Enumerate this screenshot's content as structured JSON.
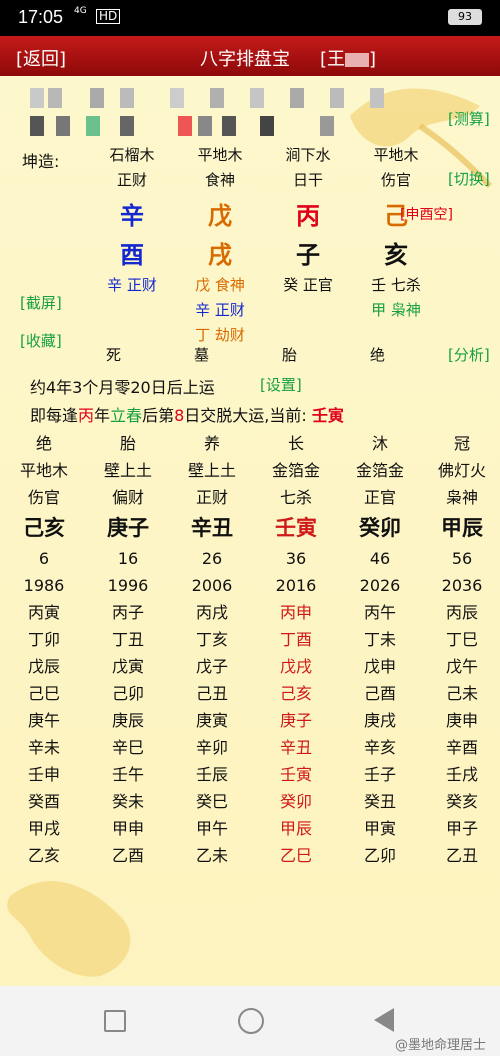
{
  "status": {
    "time": "17:05",
    "network": "4G",
    "hd": "HD",
    "battery": "93"
  },
  "header": {
    "back": "[返回]",
    "title": "八字排盘宝",
    "name_prefix": "[王",
    "name_suffix": "]"
  },
  "buttons": {
    "measure": "[测算]",
    "switch": "[切换]",
    "screenshot": "[截屏]",
    "favorite": "[收藏]",
    "analysis": "[分析]",
    "settings": "[设置]"
  },
  "chart": {
    "label": "坤造:",
    "nayin": [
      "石榴木",
      "平地木",
      "涧下水",
      "平地木"
    ],
    "shishen": [
      "正财",
      "食神",
      "日干",
      "伤官"
    ],
    "stems": [
      "辛",
      "戊",
      "丙",
      "己"
    ],
    "branches": [
      "酉",
      "戌",
      "子",
      "亥"
    ],
    "void_note": "[申酉空]",
    "hidden": [
      [
        "辛 正财"
      ],
      [
        "戊 食神",
        "辛 正财",
        "丁 劫财"
      ],
      [
        "癸 正官"
      ],
      [
        "壬 七杀",
        "甲 枭神"
      ]
    ],
    "changsheng": [
      "死",
      "墓",
      "胎",
      "绝"
    ]
  },
  "yun": {
    "line1": "约4年3个月零20日后上运",
    "line2_a": "即每逢",
    "line2_b": "丙",
    "line2_c": "年",
    "line2_d": "立春",
    "line2_e": "后第",
    "line2_f": "8",
    "line2_g": "日交脱大运,当前: ",
    "line2_h": "壬寅"
  },
  "dayun": [
    {
      "cs": "绝",
      "nayin": "平地木",
      "shishen": "伤官",
      "gz": "己亥",
      "age": "6",
      "year": "1986",
      "years": [
        "丙寅",
        "丁卯",
        "戊辰",
        "己巳",
        "庚午",
        "辛未",
        "壬申",
        "癸酉",
        "甲戌",
        "乙亥"
      ]
    },
    {
      "cs": "胎",
      "nayin": "壁上土",
      "shishen": "偏财",
      "gz": "庚子",
      "age": "16",
      "year": "1996",
      "years": [
        "丙子",
        "丁丑",
        "戊寅",
        "己卯",
        "庚辰",
        "辛巳",
        "壬午",
        "癸未",
        "甲申",
        "乙酉"
      ]
    },
    {
      "cs": "养",
      "nayin": "壁上土",
      "shishen": "正财",
      "gz": "辛丑",
      "age": "26",
      "year": "2006",
      "years": [
        "丙戌",
        "丁亥",
        "戊子",
        "己丑",
        "庚寅",
        "辛卯",
        "壬辰",
        "癸巳",
        "甲午",
        "乙未"
      ]
    },
    {
      "cs": "长",
      "nayin": "金箔金",
      "shishen": "七杀",
      "gz": "壬寅",
      "age": "36",
      "year": "2016",
      "years": [
        "丙申",
        "丁酉",
        "戊戌",
        "己亥",
        "庚子",
        "辛丑",
        "壬寅",
        "癸卯",
        "甲辰",
        "乙巳"
      ]
    },
    {
      "cs": "沐",
      "nayin": "金箔金",
      "shishen": "正官",
      "gz": "癸卯",
      "age": "46",
      "year": "2026",
      "years": [
        "丙午",
        "丁未",
        "戊申",
        "己酉",
        "庚戌",
        "辛亥",
        "壬子",
        "癸丑",
        "甲寅",
        "乙卯"
      ]
    },
    {
      "cs": "冠",
      "nayin": "佛灯火",
      "shishen": "枭神",
      "gz": "甲辰",
      "age": "56",
      "year": "2036",
      "years": [
        "丙辰",
        "丁巳",
        "戊午",
        "己未",
        "庚申",
        "辛酉",
        "壬戌",
        "癸亥",
        "甲子",
        "乙丑"
      ]
    }
  ],
  "watermark": "@墨地命理居士"
}
